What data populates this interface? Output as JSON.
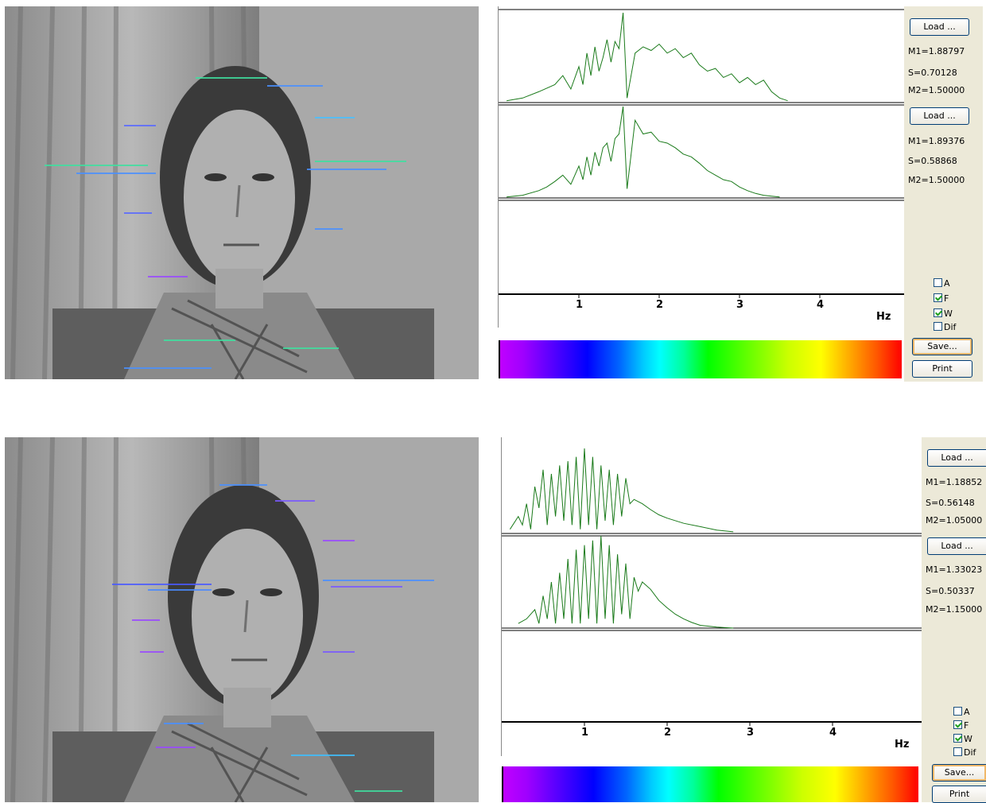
{
  "panels": [
    {
      "load_buttons": [
        "Load ...",
        "Load ..."
      ],
      "stats1": {
        "m1": "M1=1.88797",
        "s": "S=0.70128",
        "m2": "M2=1.50000"
      },
      "stats2": {
        "m1": "M1=1.89376",
        "s": "S=0.58868",
        "m2": "M2=1.50000"
      },
      "checkboxes": [
        {
          "label": "A",
          "checked": false
        },
        {
          "label": "F",
          "checked": true
        },
        {
          "label": "W",
          "checked": true
        },
        {
          "label": "Dif",
          "checked": false
        }
      ],
      "save_label": "Save...",
      "print_label": "Print",
      "axis": {
        "ticks": [
          "1",
          "2",
          "3",
          "4"
        ],
        "unit": "Hz"
      }
    },
    {
      "load_buttons": [
        "Load ...",
        "Load ..."
      ],
      "stats1": {
        "m1": "M1=1.18852",
        "s": "S=0.56148",
        "m2": "M2=1.05000"
      },
      "stats2": {
        "m1": "M1=1.33023",
        "s": "S=0.50337",
        "m2": "M2=1.15000"
      },
      "checkboxes": [
        {
          "label": "A",
          "checked": false
        },
        {
          "label": "F",
          "checked": true
        },
        {
          "label": "W",
          "checked": true
        },
        {
          "label": "Dif",
          "checked": false
        }
      ],
      "save_label": "Save...",
      "print_label": "Print",
      "axis": {
        "ticks": [
          "1",
          "2",
          "3",
          "4"
        ],
        "unit": "Hz"
      }
    }
  ],
  "chart_data": [
    {
      "type": "line",
      "series": [
        {
          "x": [
            0.1,
            0.3,
            0.5,
            0.7,
            0.8,
            0.9,
            1.0,
            1.05,
            1.1,
            1.15,
            1.2,
            1.25,
            1.3,
            1.35,
            1.4,
            1.45,
            1.5,
            1.55,
            1.6,
            1.7,
            1.8,
            1.9,
            2.0,
            2.1,
            2.2,
            2.3,
            2.4,
            2.5,
            2.6,
            2.7,
            2.8,
            2.9,
            3.0,
            3.1,
            3.2,
            3.3,
            3.4,
            3.5,
            3.6
          ],
          "y": [
            0.02,
            0.05,
            0.12,
            0.2,
            0.3,
            0.15,
            0.4,
            0.2,
            0.55,
            0.3,
            0.62,
            0.35,
            0.5,
            0.7,
            0.45,
            0.68,
            0.6,
            1.0,
            0.05,
            0.55,
            0.62,
            0.58,
            0.65,
            0.55,
            0.6,
            0.5,
            0.55,
            0.42,
            0.35,
            0.38,
            0.28,
            0.32,
            0.22,
            0.28,
            0.2,
            0.25,
            0.12,
            0.05,
            0.02
          ]
        }
      ],
      "color": "#1a7a1a",
      "xlim": [
        0,
        5
      ],
      "ylim": [
        0,
        1
      ]
    },
    {
      "type": "line",
      "series": [
        {
          "x": [
            0.1,
            0.3,
            0.5,
            0.6,
            0.7,
            0.8,
            0.9,
            1.0,
            1.05,
            1.1,
            1.15,
            1.2,
            1.25,
            1.3,
            1.35,
            1.4,
            1.45,
            1.5,
            1.55,
            1.6,
            1.7,
            1.8,
            1.9,
            2.0,
            2.1,
            2.2,
            2.3,
            2.4,
            2.5,
            2.6,
            2.7,
            2.8,
            2.9,
            3.0,
            3.1,
            3.2,
            3.3,
            3.4,
            3.5
          ],
          "y": [
            0.01,
            0.03,
            0.08,
            0.12,
            0.18,
            0.25,
            0.15,
            0.35,
            0.2,
            0.45,
            0.25,
            0.5,
            0.35,
            0.55,
            0.6,
            0.4,
            0.65,
            0.7,
            1.0,
            0.1,
            0.85,
            0.7,
            0.72,
            0.62,
            0.6,
            0.55,
            0.48,
            0.45,
            0.38,
            0.3,
            0.25,
            0.2,
            0.18,
            0.12,
            0.08,
            0.05,
            0.03,
            0.02,
            0.01
          ]
        }
      ],
      "color": "#1a7a1a",
      "xlim": [
        0,
        5
      ],
      "ylim": [
        0,
        1
      ]
    },
    {
      "type": "line",
      "series": [
        {
          "x": [
            0.1,
            0.2,
            0.25,
            0.3,
            0.35,
            0.4,
            0.45,
            0.5,
            0.55,
            0.6,
            0.65,
            0.7,
            0.75,
            0.8,
            0.85,
            0.9,
            0.95,
            1.0,
            1.05,
            1.1,
            1.15,
            1.2,
            1.25,
            1.3,
            1.35,
            1.4,
            1.45,
            1.5,
            1.55,
            1.6,
            1.7,
            1.8,
            1.9,
            2.0,
            2.2,
            2.4,
            2.6,
            2.8
          ],
          "y": [
            0.05,
            0.2,
            0.1,
            0.35,
            0.05,
            0.55,
            0.3,
            0.75,
            0.1,
            0.7,
            0.2,
            0.8,
            0.15,
            0.85,
            0.1,
            0.9,
            0.05,
            1.0,
            0.1,
            0.9,
            0.05,
            0.8,
            0.15,
            0.75,
            0.1,
            0.7,
            0.2,
            0.65,
            0.35,
            0.4,
            0.35,
            0.28,
            0.22,
            0.18,
            0.12,
            0.08,
            0.04,
            0.02
          ]
        }
      ],
      "color": "#1a7a1a",
      "xlim": [
        0,
        5
      ],
      "ylim": [
        0,
        1
      ]
    },
    {
      "type": "line",
      "series": [
        {
          "x": [
            0.2,
            0.3,
            0.4,
            0.45,
            0.5,
            0.55,
            0.6,
            0.65,
            0.7,
            0.75,
            0.8,
            0.85,
            0.9,
            0.95,
            1.0,
            1.05,
            1.1,
            1.15,
            1.2,
            1.25,
            1.3,
            1.35,
            1.4,
            1.45,
            1.5,
            1.55,
            1.6,
            1.65,
            1.7,
            1.8,
            1.9,
            2.0,
            2.1,
            2.2,
            2.3,
            2.4,
            2.6,
            2.8
          ],
          "y": [
            0.05,
            0.1,
            0.2,
            0.05,
            0.35,
            0.1,
            0.5,
            0.05,
            0.6,
            0.1,
            0.75,
            0.05,
            0.85,
            0.05,
            0.9,
            0.1,
            0.95,
            0.05,
            1.0,
            0.1,
            0.9,
            0.05,
            0.8,
            0.15,
            0.7,
            0.1,
            0.55,
            0.4,
            0.5,
            0.42,
            0.3,
            0.22,
            0.15,
            0.1,
            0.06,
            0.03,
            0.01,
            0.0
          ]
        }
      ],
      "color": "#1a7a1a",
      "xlim": [
        0,
        5
      ],
      "ylim": [
        0,
        1
      ]
    }
  ]
}
